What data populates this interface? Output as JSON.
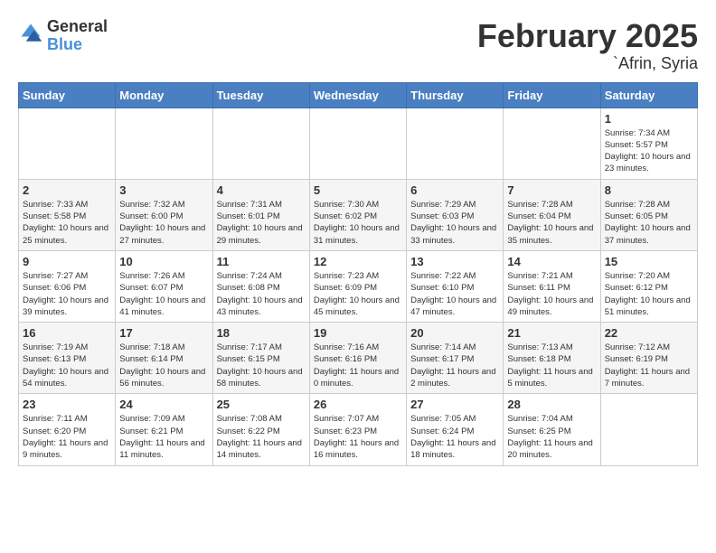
{
  "logo": {
    "general": "General",
    "blue": "Blue"
  },
  "title": "February 2025",
  "subtitle": "`Afrin, Syria",
  "days_of_week": [
    "Sunday",
    "Monday",
    "Tuesday",
    "Wednesday",
    "Thursday",
    "Friday",
    "Saturday"
  ],
  "weeks": [
    [
      {
        "day": "",
        "info": ""
      },
      {
        "day": "",
        "info": ""
      },
      {
        "day": "",
        "info": ""
      },
      {
        "day": "",
        "info": ""
      },
      {
        "day": "",
        "info": ""
      },
      {
        "day": "",
        "info": ""
      },
      {
        "day": "1",
        "info": "Sunrise: 7:34 AM\nSunset: 5:57 PM\nDaylight: 10 hours and 23 minutes."
      }
    ],
    [
      {
        "day": "2",
        "info": "Sunrise: 7:33 AM\nSunset: 5:58 PM\nDaylight: 10 hours and 25 minutes."
      },
      {
        "day": "3",
        "info": "Sunrise: 7:32 AM\nSunset: 6:00 PM\nDaylight: 10 hours and 27 minutes."
      },
      {
        "day": "4",
        "info": "Sunrise: 7:31 AM\nSunset: 6:01 PM\nDaylight: 10 hours and 29 minutes."
      },
      {
        "day": "5",
        "info": "Sunrise: 7:30 AM\nSunset: 6:02 PM\nDaylight: 10 hours and 31 minutes."
      },
      {
        "day": "6",
        "info": "Sunrise: 7:29 AM\nSunset: 6:03 PM\nDaylight: 10 hours and 33 minutes."
      },
      {
        "day": "7",
        "info": "Sunrise: 7:28 AM\nSunset: 6:04 PM\nDaylight: 10 hours and 35 minutes."
      },
      {
        "day": "8",
        "info": "Sunrise: 7:28 AM\nSunset: 6:05 PM\nDaylight: 10 hours and 37 minutes."
      }
    ],
    [
      {
        "day": "9",
        "info": "Sunrise: 7:27 AM\nSunset: 6:06 PM\nDaylight: 10 hours and 39 minutes."
      },
      {
        "day": "10",
        "info": "Sunrise: 7:26 AM\nSunset: 6:07 PM\nDaylight: 10 hours and 41 minutes."
      },
      {
        "day": "11",
        "info": "Sunrise: 7:24 AM\nSunset: 6:08 PM\nDaylight: 10 hours and 43 minutes."
      },
      {
        "day": "12",
        "info": "Sunrise: 7:23 AM\nSunset: 6:09 PM\nDaylight: 10 hours and 45 minutes."
      },
      {
        "day": "13",
        "info": "Sunrise: 7:22 AM\nSunset: 6:10 PM\nDaylight: 10 hours and 47 minutes."
      },
      {
        "day": "14",
        "info": "Sunrise: 7:21 AM\nSunset: 6:11 PM\nDaylight: 10 hours and 49 minutes."
      },
      {
        "day": "15",
        "info": "Sunrise: 7:20 AM\nSunset: 6:12 PM\nDaylight: 10 hours and 51 minutes."
      }
    ],
    [
      {
        "day": "16",
        "info": "Sunrise: 7:19 AM\nSunset: 6:13 PM\nDaylight: 10 hours and 54 minutes."
      },
      {
        "day": "17",
        "info": "Sunrise: 7:18 AM\nSunset: 6:14 PM\nDaylight: 10 hours and 56 minutes."
      },
      {
        "day": "18",
        "info": "Sunrise: 7:17 AM\nSunset: 6:15 PM\nDaylight: 10 hours and 58 minutes."
      },
      {
        "day": "19",
        "info": "Sunrise: 7:16 AM\nSunset: 6:16 PM\nDaylight: 11 hours and 0 minutes."
      },
      {
        "day": "20",
        "info": "Sunrise: 7:14 AM\nSunset: 6:17 PM\nDaylight: 11 hours and 2 minutes."
      },
      {
        "day": "21",
        "info": "Sunrise: 7:13 AM\nSunset: 6:18 PM\nDaylight: 11 hours and 5 minutes."
      },
      {
        "day": "22",
        "info": "Sunrise: 7:12 AM\nSunset: 6:19 PM\nDaylight: 11 hours and 7 minutes."
      }
    ],
    [
      {
        "day": "23",
        "info": "Sunrise: 7:11 AM\nSunset: 6:20 PM\nDaylight: 11 hours and 9 minutes."
      },
      {
        "day": "24",
        "info": "Sunrise: 7:09 AM\nSunset: 6:21 PM\nDaylight: 11 hours and 11 minutes."
      },
      {
        "day": "25",
        "info": "Sunrise: 7:08 AM\nSunset: 6:22 PM\nDaylight: 11 hours and 14 minutes."
      },
      {
        "day": "26",
        "info": "Sunrise: 7:07 AM\nSunset: 6:23 PM\nDaylight: 11 hours and 16 minutes."
      },
      {
        "day": "27",
        "info": "Sunrise: 7:05 AM\nSunset: 6:24 PM\nDaylight: 11 hours and 18 minutes."
      },
      {
        "day": "28",
        "info": "Sunrise: 7:04 AM\nSunset: 6:25 PM\nDaylight: 11 hours and 20 minutes."
      },
      {
        "day": "",
        "info": ""
      }
    ]
  ]
}
